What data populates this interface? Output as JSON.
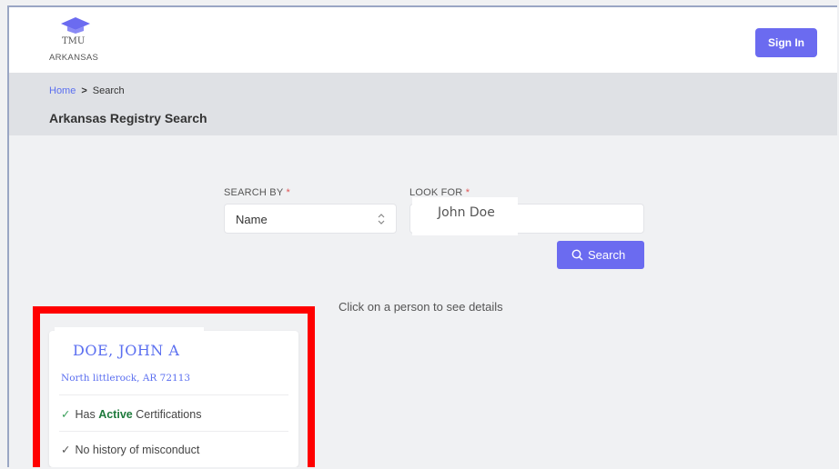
{
  "header": {
    "logo_line1": "TMU",
    "logo_line2": "ARKANSAS",
    "signin_label": "Sign In"
  },
  "breadcrumb": {
    "home": "Home",
    "separator": ">",
    "current": "Search"
  },
  "page_title": "Arkansas Registry Search",
  "search": {
    "search_by_label": "SEARCH BY",
    "look_for_label": "LOOK FOR",
    "required_mark": "*",
    "search_by_value": "Name",
    "look_for_value": "John Doe",
    "button_label": "Search"
  },
  "hint": "Click on a person to see details",
  "result": {
    "name": "DOE, JOHN A",
    "address": "North littlerock, AR 72113",
    "cert_prefix": "Has",
    "cert_status": "Active",
    "cert_suffix": "Certifications",
    "misconduct": "No history of misconduct"
  },
  "colors": {
    "accent": "#6b6bf0",
    "highlight_box": "#ff0000",
    "active_green": "#1e7a3c"
  }
}
